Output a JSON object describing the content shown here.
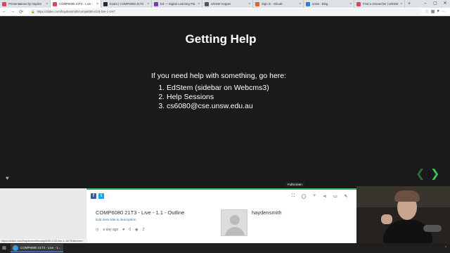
{
  "browser": {
    "tabs": [
      {
        "title": "Presentations by hayden",
        "fav_color": "#e0445a",
        "active": false
      },
      {
        "title": "COMP6080 21T3 - Live - ",
        "fav_color": "#e0445a",
        "active": true
      },
      {
        "title": "Exam | COMP6080 21T3",
        "fav_color": "#2a2a2a",
        "active": false
      },
      {
        "title": "Ed — Digital Learning Pla",
        "fav_color": "#7a3ab8",
        "active": false
      },
      {
        "title": "UNSW Hopper",
        "fav_color": "#555555",
        "active": false
      },
      {
        "title": "Sign in · GitLab",
        "fav_color": "#e2651f",
        "active": false
      },
      {
        "title": "unsw - Bing",
        "fav_color": "#2b7cd3",
        "active": false
      },
      {
        "title": "Find a researcher | UNSW",
        "fav_color": "#e0445a",
        "active": false
      }
    ],
    "url": "https://slides.com/haydensmith/comp6080-21t3-live-1-1#/7",
    "status_url": "https://slides.com/haydensmith/comp6080-21t3-live-1-1#/7/fullscreen"
  },
  "slide": {
    "title": "Getting Help",
    "intro": "If you need help with something, go here:",
    "items": [
      "EdStem (sidebar on Webcms3)",
      "Help Sessions",
      "cs6080@cse.unsw.edu.au"
    ]
  },
  "toolbar": {
    "tooltip": "Fullscreen"
  },
  "deck": {
    "title": "COMP6080 21T3 - Live - 1.1 - Outline",
    "edit_label": "Edit deck title & description",
    "age": "a day ago",
    "likes": "0",
    "views": "2",
    "author": "haydensmith"
  },
  "taskbar": {
    "app_label": "COMP6080 21T3 - Live - 1..."
  },
  "colors": {
    "accent": "#3cbd5c",
    "slide_bg": "#1a1a1a"
  }
}
